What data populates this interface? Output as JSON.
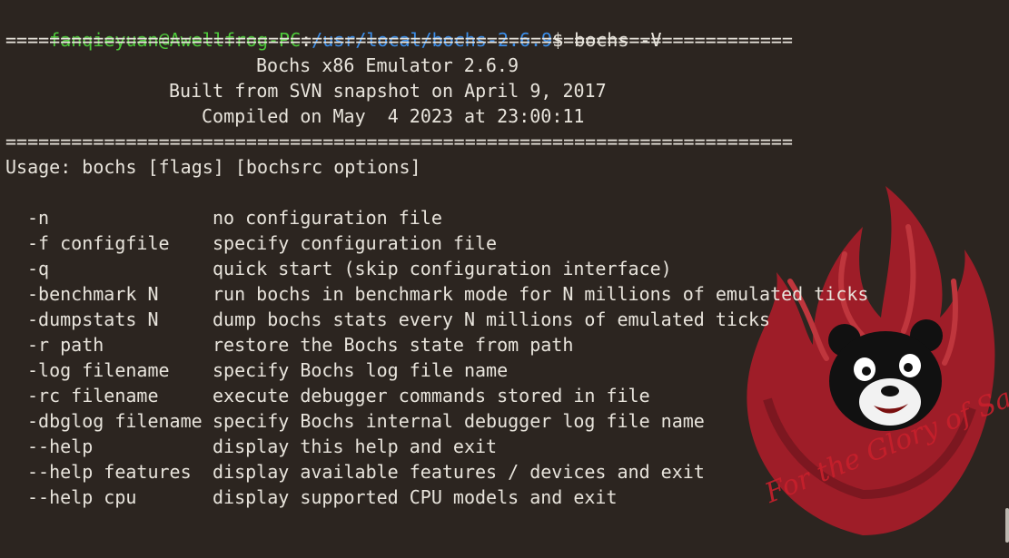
{
  "prompt": {
    "user_host": "fanqieyuan@Awellfrog-PC",
    "separator": ":",
    "path": "/usr/local/bochs-2.6.9",
    "symbol": "$",
    "command": "bochs -V"
  },
  "banner": {
    "rule": "========================================================================",
    "title": "Bochs x86 Emulator 2.6.9",
    "build": "Built from SVN snapshot on April 9, 2017",
    "compiled": "Compiled on May  4 2023 at 23:00:11"
  },
  "usage": "Usage: bochs [flags] [bochsrc options]",
  "options": [
    {
      "flag": "-n",
      "description": "no configuration file"
    },
    {
      "flag": "-f configfile",
      "description": "specify configuration file"
    },
    {
      "flag": "-q",
      "description": "quick start (skip configuration interface)"
    },
    {
      "flag": "-benchmark N",
      "description": "run bochs in benchmark mode for N millions of emulated ticks"
    },
    {
      "flag": "-dumpstats N",
      "description": "dump bochs stats every N millions of emulated ticks"
    },
    {
      "flag": "-r path",
      "description": "restore the Bochs state from path"
    },
    {
      "flag": "-log filename",
      "description": "specify Bochs log file name"
    },
    {
      "flag": "-rc filename",
      "description": "execute debugger commands stored in file"
    },
    {
      "flag": "-dbglog filename",
      "description": "specify Bochs internal debugger log file name"
    },
    {
      "flag": "--help",
      "description": "display this help and exit"
    },
    {
      "flag": "--help features",
      "description": "display available features / devices and exit"
    },
    {
      "flag": "--help cpu",
      "description": "display supported CPU models and exit"
    }
  ],
  "wallpaper_text": "For the Glory of Satan",
  "colors": {
    "background": "#2c2520",
    "text": "#e8e4dc",
    "prompt_user": "#4dc93a",
    "prompt_path": "#3b8eea",
    "flame": "#c8202c"
  }
}
